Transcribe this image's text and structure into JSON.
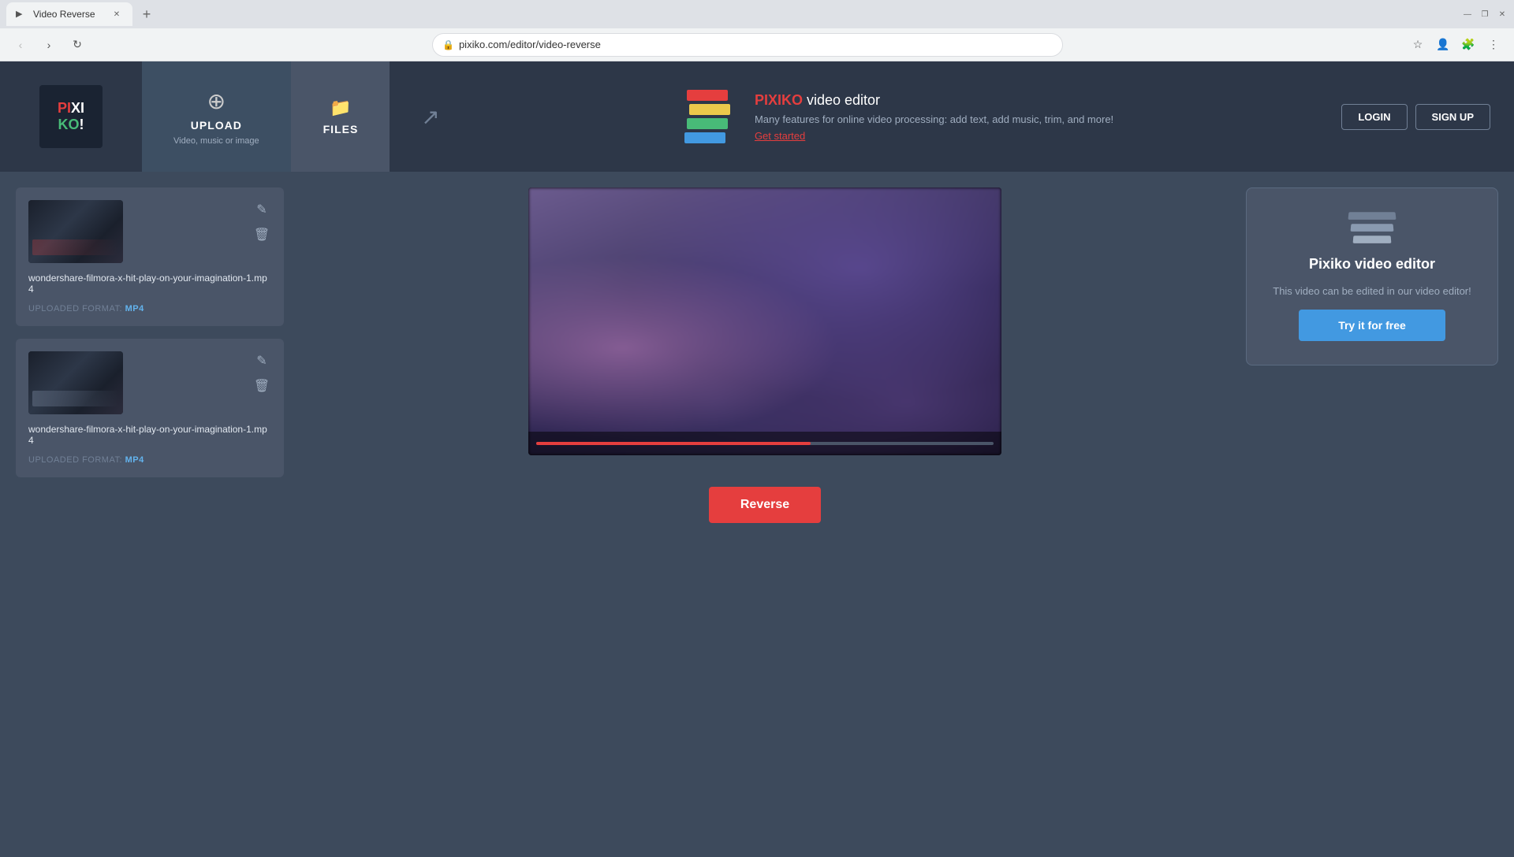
{
  "browser": {
    "tab": {
      "title": "Video Reverse",
      "favicon": "▶"
    },
    "url": "pixiko.com/editor/video-reverse"
  },
  "header": {
    "logo": {
      "line1": "PIXI",
      "line2": "KO!"
    },
    "upload": {
      "label": "UPLOAD",
      "sublabel": "Video, music\nor image",
      "icon": "⊕"
    },
    "files": {
      "label": "FILES",
      "icon": "📁"
    },
    "share": {
      "icon": "↗"
    },
    "promo": {
      "title_brand": "PIXIKO",
      "title_rest": " video editor",
      "description": "Many features for online video processing: add text, add music, trim, and more!",
      "link": "Get started"
    },
    "login_label": "LOGIN",
    "signup_label": "SIGN UP"
  },
  "sidebar": {
    "file1": {
      "name": "wondershare-filmora-x-hit-play-on-your-imagination-1.mp4",
      "format_label": "UPLOADED FORMAT:",
      "format_value": "MP4",
      "edit_icon": "✎",
      "delete_icon": "🗑"
    },
    "file2": {
      "name": "wondershare-filmora-x-hit-play-on-your-imagination-1.mp4",
      "format_label": "UPLOADED FORMAT:",
      "format_value": "MP4",
      "edit_icon": "✎",
      "delete_icon": "🗑"
    }
  },
  "video": {
    "reverse_button": "Reverse"
  },
  "right_panel": {
    "title": "Pixiko video editor",
    "description": "This video can be edited in our video editor!",
    "try_button": "Try it for free"
  }
}
